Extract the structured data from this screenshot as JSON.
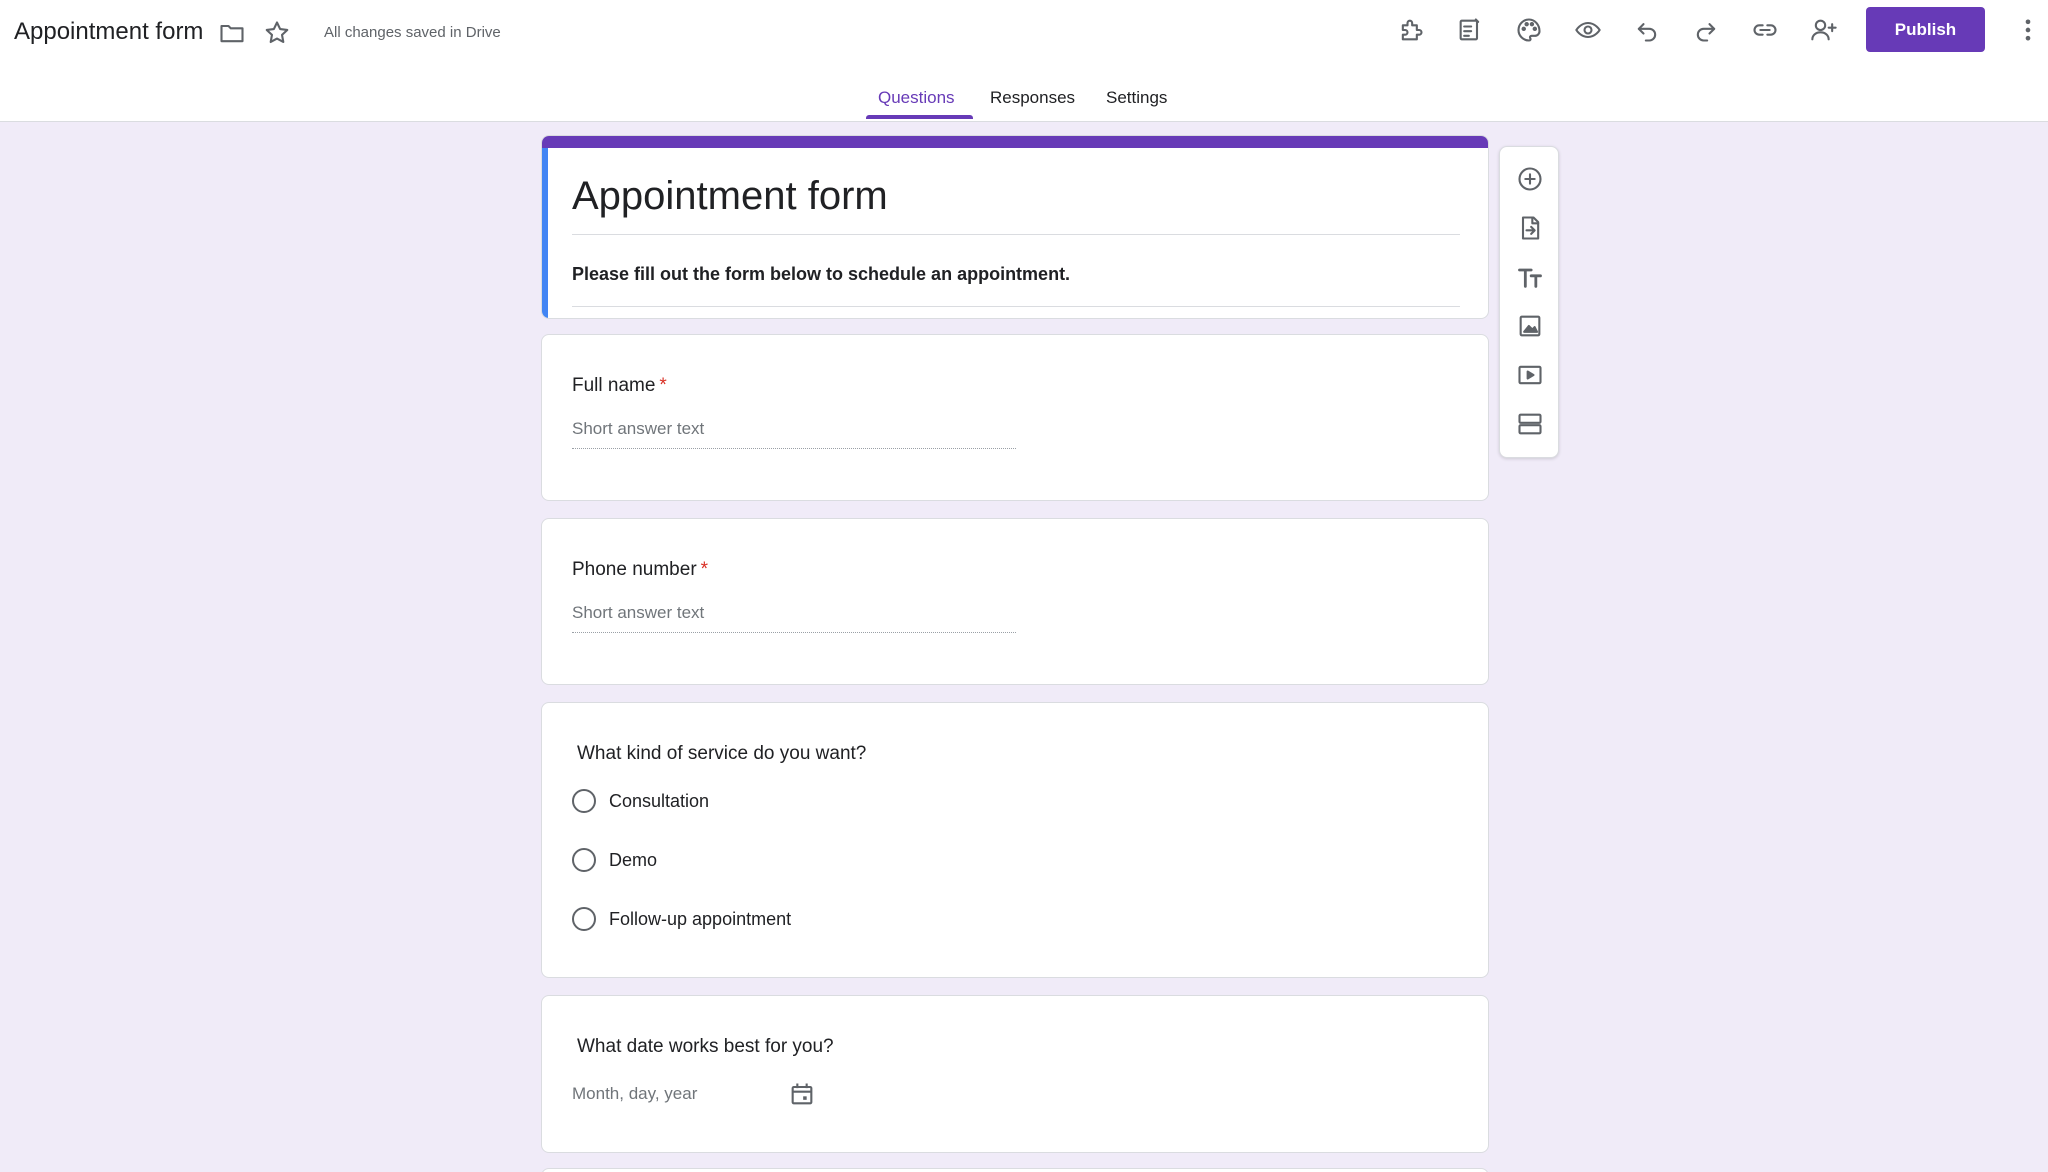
{
  "header": {
    "doc_title": "Appointment form",
    "save_status": "All changes saved in Drive",
    "publish_label": "Publish",
    "icons": [
      "folder-icon",
      "star-icon",
      "addons-icon",
      "customize-form-icon",
      "theme-palette-icon",
      "preview-eye-icon",
      "undo-icon",
      "redo-icon",
      "link-icon",
      "add-collaborator-icon",
      "more-vert-icon"
    ]
  },
  "tabs": [
    {
      "label": "Questions",
      "active": true
    },
    {
      "label": "Responses",
      "active": false
    },
    {
      "label": "Settings",
      "active": false
    }
  ],
  "form": {
    "title": "Appointment form",
    "description": "Please fill out the form below to schedule an appointment."
  },
  "questions": [
    {
      "title": "Full name",
      "required": true,
      "placeholder": "Short answer text"
    },
    {
      "title": "Phone number",
      "required": true,
      "placeholder": "Short answer text"
    },
    {
      "title": "What kind of service do you want?",
      "required": false,
      "options": [
        "Consultation",
        "Demo",
        "Follow-up appointment"
      ]
    },
    {
      "title": "What date works best for you?",
      "required": false,
      "placeholder": "Month, day, year"
    }
  ],
  "required_marker": "*",
  "toolbar": {
    "icons": [
      "add-question-icon",
      "import-questions-icon",
      "add-title-icon",
      "add-image-icon",
      "add-video-icon",
      "add-section-icon"
    ]
  },
  "colors": {
    "accent": "#673ab7",
    "page_bg": "#f0ebf8",
    "header_left_strip": "#4285f4",
    "required": "#d93025"
  }
}
